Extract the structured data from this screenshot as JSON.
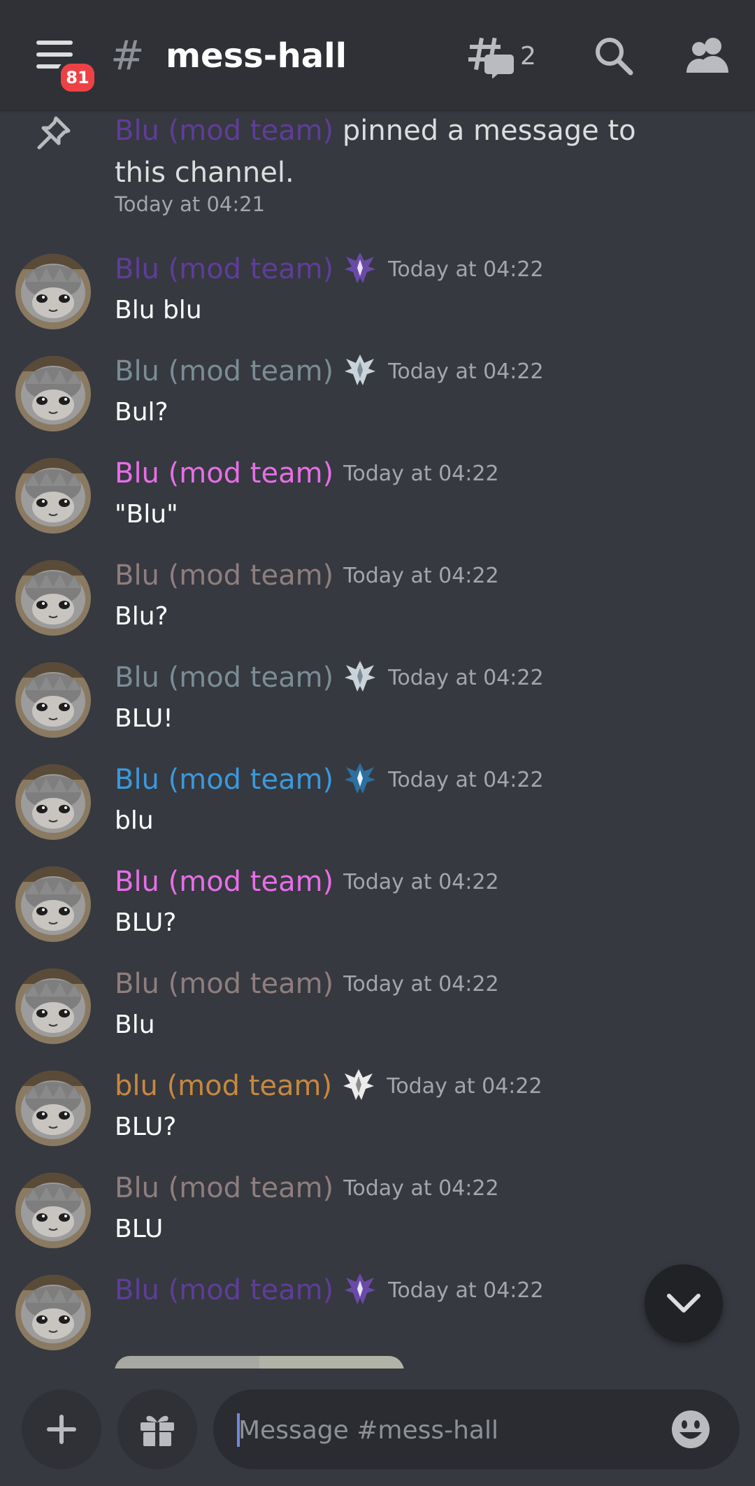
{
  "header": {
    "unread_badge": "81",
    "hash_symbol": "#",
    "channel_name": "mess-hall",
    "threads_count": "2"
  },
  "system_message": {
    "actor": "Blu (mod team)",
    "action": " pinned a message to this channel.",
    "timestamp": "Today at 04:21",
    "actor_color": "#5f3d9a"
  },
  "messages": [
    {
      "author": "Blu (mod team)",
      "color": "#5f3d9a",
      "role_icon": "purple-crest-icon",
      "time": "Today at 04:22",
      "text": "Blu blu"
    },
    {
      "author": "Blu (mod team)",
      "color": "#7b8c96",
      "role_icon": "silver-crest-icon",
      "time": "Today at 04:22",
      "text": "Bul?"
    },
    {
      "author": "Blu (mod team)",
      "color": "#e76ee8",
      "role_icon": "",
      "time": "Today at 04:22",
      "text": "\"Blu\""
    },
    {
      "author": "Blu (mod team)",
      "color": "#8f7e7e",
      "role_icon": "",
      "time": "Today at 04:22",
      "text": "Blu?"
    },
    {
      "author": "Blu (mod team)",
      "color": "#7b8c96",
      "role_icon": "silver-crest-icon",
      "time": "Today at 04:22",
      "text": "BLU!"
    },
    {
      "author": "Blu (mod team)",
      "color": "#3b99db",
      "role_icon": "blue-crest-icon",
      "time": "Today at 04:22",
      "text": "blu"
    },
    {
      "author": "Blu (mod team)",
      "color": "#e76ee8",
      "role_icon": "",
      "time": "Today at 04:22",
      "text": "BLU?"
    },
    {
      "author": "Blu (mod team)",
      "color": "#8f7e7e",
      "role_icon": "",
      "time": "Today at 04:22",
      "text": "Blu"
    },
    {
      "author": "blu (mod team)",
      "color": "#c8883f",
      "role_icon": "white-crest-icon",
      "time": "Today at 04:22",
      "text": "BLU?"
    },
    {
      "author": "Blu (mod team)",
      "color": "#8f7e7e",
      "role_icon": "",
      "time": "Today at 04:22",
      "text": "BLU"
    },
    {
      "author": "Blu (mod team)",
      "color": "#5f3d9a",
      "role_icon": "purple-crest-icon",
      "time": "Today at 04:22",
      "text": ""
    }
  ],
  "composer": {
    "placeholder": "Message #mess-hall"
  },
  "colors": {
    "background": "#36393f",
    "header": "#2f3136",
    "badge": "#ed4245"
  }
}
